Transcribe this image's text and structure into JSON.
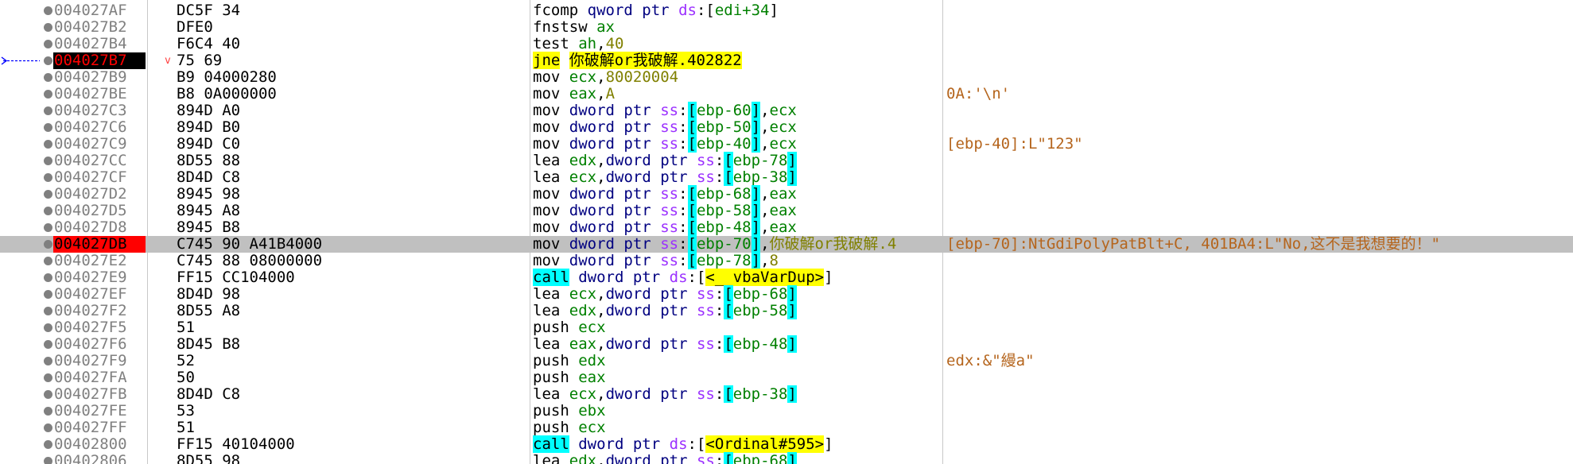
{
  "rows": [
    {
      "addr": "004027AF",
      "bytes": "DC5F 34",
      "ins": [
        [
          "m-fpu",
          "fcomp"
        ],
        [
          "t-txt",
          " "
        ],
        [
          "t-size",
          "qword ptr"
        ],
        [
          "t-txt",
          " "
        ],
        [
          "t-seg",
          "ds"
        ],
        [
          "t-txt",
          ":["
        ],
        [
          "t-regm",
          "edi+34"
        ],
        [
          "t-txt",
          "]"
        ]
      ],
      "comment": ""
    },
    {
      "addr": "004027B2",
      "bytes": "DFE0",
      "ins": [
        [
          "m-fpu",
          "fnstsw"
        ],
        [
          "t-txt",
          " "
        ],
        [
          "t-reg",
          "ax"
        ]
      ],
      "comment": ""
    },
    {
      "addr": "004027B4",
      "bytes": "F6C4 40",
      "ins": [
        [
          "m-test",
          "test"
        ],
        [
          "t-txt",
          " "
        ],
        [
          "t-reg",
          "ah"
        ],
        [
          "t-txt",
          ","
        ],
        [
          "t-num",
          "40"
        ]
      ],
      "comment": ""
    },
    {
      "addr": "004027B7",
      "bytes": "75 69",
      "ins": [
        [
          "m-jcc",
          "jne"
        ],
        [
          "t-txt",
          " "
        ],
        [
          "t-lbl",
          "你破解or我破解.402822"
        ]
      ],
      "comment": "",
      "eip": true,
      "mark": "v",
      "arrow": true
    },
    {
      "addr": "004027B9",
      "bytes": "B9 04000280",
      "ins": [
        [
          "m-mov",
          "mov"
        ],
        [
          "t-txt",
          " "
        ],
        [
          "t-reg",
          "ecx"
        ],
        [
          "t-txt",
          ","
        ],
        [
          "t-num",
          "80020004"
        ]
      ],
      "comment": ""
    },
    {
      "addr": "004027BE",
      "bytes": "B8 0A000000",
      "ins": [
        [
          "m-mov",
          "mov"
        ],
        [
          "t-txt",
          " "
        ],
        [
          "t-reg",
          "eax"
        ],
        [
          "t-txt",
          ","
        ],
        [
          "t-num",
          "A"
        ]
      ],
      "comment": "0A:'\\n'"
    },
    {
      "addr": "004027C3",
      "bytes": "894D A0",
      "ins": [
        [
          "m-mov",
          "mov"
        ],
        [
          "t-txt",
          " "
        ],
        [
          "t-size",
          "dword ptr"
        ],
        [
          "t-txt",
          " "
        ],
        [
          "t-seg",
          "ss"
        ],
        [
          "t-txt",
          ":"
        ],
        [
          "t-br",
          "["
        ],
        [
          "t-regm",
          "ebp-60"
        ],
        [
          "t-br",
          "]"
        ],
        [
          "t-txt",
          ","
        ],
        [
          "t-reg",
          "ecx"
        ]
      ],
      "comment": ""
    },
    {
      "addr": "004027C6",
      "bytes": "894D B0",
      "ins": [
        [
          "m-mov",
          "mov"
        ],
        [
          "t-txt",
          " "
        ],
        [
          "t-size",
          "dword ptr"
        ],
        [
          "t-txt",
          " "
        ],
        [
          "t-seg",
          "ss"
        ],
        [
          "t-txt",
          ":"
        ],
        [
          "t-br",
          "["
        ],
        [
          "t-regm",
          "ebp-50"
        ],
        [
          "t-br",
          "]"
        ],
        [
          "t-txt",
          ","
        ],
        [
          "t-reg",
          "ecx"
        ]
      ],
      "comment": ""
    },
    {
      "addr": "004027C9",
      "bytes": "894D C0",
      "ins": [
        [
          "m-mov",
          "mov"
        ],
        [
          "t-txt",
          " "
        ],
        [
          "t-size",
          "dword ptr"
        ],
        [
          "t-txt",
          " "
        ],
        [
          "t-seg",
          "ss"
        ],
        [
          "t-txt",
          ":"
        ],
        [
          "t-br",
          "["
        ],
        [
          "t-regm",
          "ebp-40"
        ],
        [
          "t-br",
          "]"
        ],
        [
          "t-txt",
          ","
        ],
        [
          "t-reg",
          "ecx"
        ]
      ],
      "comment": "[ebp-40]:L\"123\""
    },
    {
      "addr": "004027CC",
      "bytes": "8D55 88",
      "ins": [
        [
          "m-lea",
          "lea"
        ],
        [
          "t-txt",
          " "
        ],
        [
          "t-reg",
          "edx"
        ],
        [
          "t-txt",
          ","
        ],
        [
          "t-size",
          "dword ptr"
        ],
        [
          "t-txt",
          " "
        ],
        [
          "t-seg",
          "ss"
        ],
        [
          "t-txt",
          ":"
        ],
        [
          "t-br",
          "["
        ],
        [
          "t-regm",
          "ebp-78"
        ],
        [
          "t-br",
          "]"
        ]
      ],
      "comment": ""
    },
    {
      "addr": "004027CF",
      "bytes": "8D4D C8",
      "ins": [
        [
          "m-lea",
          "lea"
        ],
        [
          "t-txt",
          " "
        ],
        [
          "t-reg",
          "ecx"
        ],
        [
          "t-txt",
          ","
        ],
        [
          "t-size",
          "dword ptr"
        ],
        [
          "t-txt",
          " "
        ],
        [
          "t-seg",
          "ss"
        ],
        [
          "t-txt",
          ":"
        ],
        [
          "t-br",
          "["
        ],
        [
          "t-regm",
          "ebp-38"
        ],
        [
          "t-br",
          "]"
        ]
      ],
      "comment": ""
    },
    {
      "addr": "004027D2",
      "bytes": "8945 98",
      "ins": [
        [
          "m-mov",
          "mov"
        ],
        [
          "t-txt",
          " "
        ],
        [
          "t-size",
          "dword ptr"
        ],
        [
          "t-txt",
          " "
        ],
        [
          "t-seg",
          "ss"
        ],
        [
          "t-txt",
          ":"
        ],
        [
          "t-br",
          "["
        ],
        [
          "t-regm",
          "ebp-68"
        ],
        [
          "t-br",
          "]"
        ],
        [
          "t-txt",
          ","
        ],
        [
          "t-reg",
          "eax"
        ]
      ],
      "comment": ""
    },
    {
      "addr": "004027D5",
      "bytes": "8945 A8",
      "ins": [
        [
          "m-mov",
          "mov"
        ],
        [
          "t-txt",
          " "
        ],
        [
          "t-size",
          "dword ptr"
        ],
        [
          "t-txt",
          " "
        ],
        [
          "t-seg",
          "ss"
        ],
        [
          "t-txt",
          ":"
        ],
        [
          "t-br",
          "["
        ],
        [
          "t-regm",
          "ebp-58"
        ],
        [
          "t-br",
          "]"
        ],
        [
          "t-txt",
          ","
        ],
        [
          "t-reg",
          "eax"
        ]
      ],
      "comment": ""
    },
    {
      "addr": "004027D8",
      "bytes": "8945 B8",
      "ins": [
        [
          "m-mov",
          "mov"
        ],
        [
          "t-txt",
          " "
        ],
        [
          "t-size",
          "dword ptr"
        ],
        [
          "t-txt",
          " "
        ],
        [
          "t-seg",
          "ss"
        ],
        [
          "t-txt",
          ":"
        ],
        [
          "t-br",
          "["
        ],
        [
          "t-regm",
          "ebp-48"
        ],
        [
          "t-br",
          "]"
        ],
        [
          "t-txt",
          ","
        ],
        [
          "t-reg",
          "eax"
        ]
      ],
      "comment": ""
    },
    {
      "addr": "004027DB",
      "bytes": "C745 90 A41B4000",
      "ins": [
        [
          "m-mov",
          "mov"
        ],
        [
          "t-txt",
          " "
        ],
        [
          "t-size",
          "dword ptr"
        ],
        [
          "t-txt",
          " "
        ],
        [
          "t-seg",
          "ss"
        ],
        [
          "t-txt",
          ":"
        ],
        [
          "t-br",
          "["
        ],
        [
          "t-regm",
          "ebp-70"
        ],
        [
          "t-br",
          "]"
        ],
        [
          "t-txt",
          ","
        ],
        [
          "t-tail",
          "你破解or我破解.4"
        ]
      ],
      "comment": "[ebp-70]:NtGdiPolyPatBlt+C, 401BA4:L\"No,这不是我想要的！\"",
      "bp": true,
      "hl": true
    },
    {
      "addr": "004027E2",
      "bytes": "C745 88 08000000",
      "ins": [
        [
          "m-mov",
          "mov"
        ],
        [
          "t-txt",
          " "
        ],
        [
          "t-size",
          "dword ptr"
        ],
        [
          "t-txt",
          " "
        ],
        [
          "t-seg",
          "ss"
        ],
        [
          "t-txt",
          ":"
        ],
        [
          "t-br",
          "["
        ],
        [
          "t-regm",
          "ebp-78"
        ],
        [
          "t-br",
          "]"
        ],
        [
          "t-txt",
          ","
        ],
        [
          "t-num",
          "8"
        ]
      ],
      "comment": ""
    },
    {
      "addr": "004027E9",
      "bytes": "FF15 CC104000",
      "ins": [
        [
          "m-call",
          "call"
        ],
        [
          "t-txt",
          " "
        ],
        [
          "t-size",
          "dword ptr"
        ],
        [
          "t-txt",
          " "
        ],
        [
          "t-seg",
          "ds"
        ],
        [
          "t-txt",
          ":["
        ],
        [
          "t-lbl",
          "<__vbaVarDup>"
        ],
        [
          "t-txt",
          "]"
        ]
      ],
      "comment": ""
    },
    {
      "addr": "004027EF",
      "bytes": "8D4D 98",
      "ins": [
        [
          "m-lea",
          "lea"
        ],
        [
          "t-txt",
          " "
        ],
        [
          "t-reg",
          "ecx"
        ],
        [
          "t-txt",
          ","
        ],
        [
          "t-size",
          "dword ptr"
        ],
        [
          "t-txt",
          " "
        ],
        [
          "t-seg",
          "ss"
        ],
        [
          "t-txt",
          ":"
        ],
        [
          "t-br",
          "["
        ],
        [
          "t-regm",
          "ebp-68"
        ],
        [
          "t-br",
          "]"
        ]
      ],
      "comment": ""
    },
    {
      "addr": "004027F2",
      "bytes": "8D55 A8",
      "ins": [
        [
          "m-lea",
          "lea"
        ],
        [
          "t-txt",
          " "
        ],
        [
          "t-reg",
          "edx"
        ],
        [
          "t-txt",
          ","
        ],
        [
          "t-size",
          "dword ptr"
        ],
        [
          "t-txt",
          " "
        ],
        [
          "t-seg",
          "ss"
        ],
        [
          "t-txt",
          ":"
        ],
        [
          "t-br",
          "["
        ],
        [
          "t-regm",
          "ebp-58"
        ],
        [
          "t-br",
          "]"
        ]
      ],
      "comment": ""
    },
    {
      "addr": "004027F5",
      "bytes": "51",
      "ins": [
        [
          "m-push",
          "push"
        ],
        [
          "t-txt",
          " "
        ],
        [
          "t-reg",
          "ecx"
        ]
      ],
      "comment": ""
    },
    {
      "addr": "004027F6",
      "bytes": "8D45 B8",
      "ins": [
        [
          "m-lea",
          "lea"
        ],
        [
          "t-txt",
          " "
        ],
        [
          "t-reg",
          "eax"
        ],
        [
          "t-txt",
          ","
        ],
        [
          "t-size",
          "dword ptr"
        ],
        [
          "t-txt",
          " "
        ],
        [
          "t-seg",
          "ss"
        ],
        [
          "t-txt",
          ":"
        ],
        [
          "t-br",
          "["
        ],
        [
          "t-regm",
          "ebp-48"
        ],
        [
          "t-br",
          "]"
        ]
      ],
      "comment": ""
    },
    {
      "addr": "004027F9",
      "bytes": "52",
      "ins": [
        [
          "m-push",
          "push"
        ],
        [
          "t-txt",
          " "
        ],
        [
          "t-reg",
          "edx"
        ]
      ],
      "comment": "edx:&\"縵a\""
    },
    {
      "addr": "004027FA",
      "bytes": "50",
      "ins": [
        [
          "m-push",
          "push"
        ],
        [
          "t-txt",
          " "
        ],
        [
          "t-reg",
          "eax"
        ]
      ],
      "comment": ""
    },
    {
      "addr": "004027FB",
      "bytes": "8D4D C8",
      "ins": [
        [
          "m-lea",
          "lea"
        ],
        [
          "t-txt",
          " "
        ],
        [
          "t-reg",
          "ecx"
        ],
        [
          "t-txt",
          ","
        ],
        [
          "t-size",
          "dword ptr"
        ],
        [
          "t-txt",
          " "
        ],
        [
          "t-seg",
          "ss"
        ],
        [
          "t-txt",
          ":"
        ],
        [
          "t-br",
          "["
        ],
        [
          "t-regm",
          "ebp-38"
        ],
        [
          "t-br",
          "]"
        ]
      ],
      "comment": ""
    },
    {
      "addr": "004027FE",
      "bytes": "53",
      "ins": [
        [
          "m-push",
          "push"
        ],
        [
          "t-txt",
          " "
        ],
        [
          "t-reg",
          "ebx"
        ]
      ],
      "comment": ""
    },
    {
      "addr": "004027FF",
      "bytes": "51",
      "ins": [
        [
          "m-push",
          "push"
        ],
        [
          "t-txt",
          " "
        ],
        [
          "t-reg",
          "ecx"
        ]
      ],
      "comment": ""
    },
    {
      "addr": "00402800",
      "bytes": "FF15 40104000",
      "ins": [
        [
          "m-call",
          "call"
        ],
        [
          "t-txt",
          " "
        ],
        [
          "t-size",
          "dword ptr"
        ],
        [
          "t-txt",
          " "
        ],
        [
          "t-seg",
          "ds"
        ],
        [
          "t-txt",
          ":["
        ],
        [
          "t-lbl",
          "<Ordinal#595>"
        ],
        [
          "t-txt",
          "]"
        ]
      ],
      "comment": ""
    },
    {
      "addr": "00402806",
      "bytes": "8D55 98",
      "ins": [
        [
          "m-lea",
          "lea"
        ],
        [
          "t-txt",
          " "
        ],
        [
          "t-reg",
          "edx"
        ],
        [
          "t-txt",
          ","
        ],
        [
          "t-size",
          "dword ptr"
        ],
        [
          "t-txt",
          " "
        ],
        [
          "t-seg",
          "ss"
        ],
        [
          "t-txt",
          ":"
        ],
        [
          "t-br",
          "["
        ],
        [
          "t-regm",
          "ebp-68"
        ],
        [
          "t-br",
          "]"
        ]
      ],
      "comment": ""
    }
  ]
}
